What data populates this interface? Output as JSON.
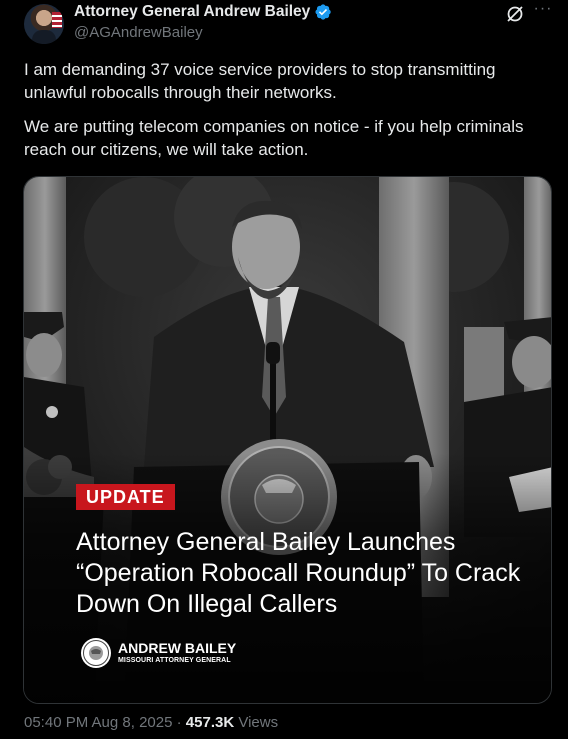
{
  "author": {
    "display_name": "Attorney General Andrew Bailey",
    "handle": "@AGAndrewBailey",
    "verified": true,
    "avatar_icon": "profile-photo"
  },
  "header_actions": {
    "grok_icon": "grok-icon",
    "more_label": "···"
  },
  "tweet": {
    "paragraphs": [
      "I am demanding 37 voice service providers to stop transmitting unlawful robocalls through their networks.",
      "We are putting telecom companies on notice - if you help criminals reach our citizens, we will take action."
    ]
  },
  "media": {
    "badge": "UPDATE",
    "headline": "Attorney General Bailey Launches “Operation Robocall Roundup” To Crack Down On Illegal Callers",
    "brand_name": "ANDREW BAILEY",
    "brand_sub": "MISSOURI ATTORNEY GENERAL",
    "seal_text": "GREAT SEAL OF THE STATE OF MISSOURI",
    "badge_color": "#c8161d"
  },
  "footer": {
    "timestamp": "05:40 PM Aug 8, 2025",
    "separator": "·",
    "views_count": "457.3K",
    "views_label": "Views"
  },
  "colors": {
    "background": "#000000",
    "text_primary": "#e7e9ea",
    "text_secondary": "#71767b",
    "verified_blue": "#1d9bf0"
  }
}
